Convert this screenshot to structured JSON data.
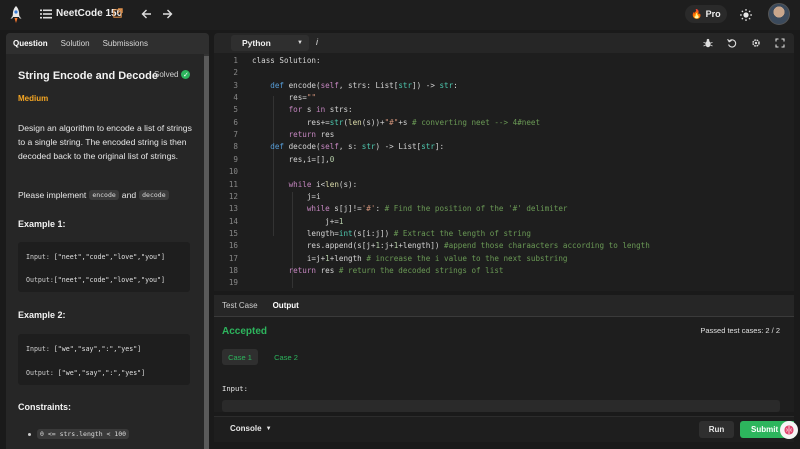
{
  "header": {
    "brand": "NeetCode 150",
    "pro_label": "Pro"
  },
  "left_panel": {
    "tabs": [
      {
        "label": "Question",
        "active": true
      },
      {
        "label": "Solution",
        "active": false
      },
      {
        "label": "Submissions",
        "active": false
      }
    ],
    "title": "String Encode and Decode",
    "solved_label": "Solved",
    "difficulty": "Medium",
    "description": "Design an algorithm to encode a list of strings to a single string. The encoded string is then decoded back to the original list of strings.",
    "implement_prefix": "Please implement",
    "implement_fn1": "encode",
    "implement_and": "and",
    "implement_fn2": "decode",
    "example1": {
      "title": "Example 1:",
      "input_label": "Input:",
      "input_value": "[\"neet\",\"code\",\"love\",\"you\"]",
      "output_label": "Output:",
      "output_value": "[\"neet\",\"code\",\"love\",\"you\"]"
    },
    "example2": {
      "title": "Example 2:",
      "input_label": "Input:",
      "input_value": "[\"we\",\"say\",\":\",\"yes\"]",
      "output_label": "Output:",
      "output_value": "[\"we\",\"say\",\":\",\"yes\"]"
    },
    "constraints_title": "Constraints:",
    "constraint1": "0 <= strs.length < 100"
  },
  "editor": {
    "language": "Python",
    "info_label": "i",
    "lines": [
      [
        {
          "t": "class Solution:",
          "c": "#d4d4d4"
        }
      ],
      [],
      [
        {
          "t": "    def ",
          "c": "#569cd6"
        },
        {
          "t": "encode(",
          "c": "#d4d4d4"
        },
        {
          "t": "self",
          "c": "#c586c0"
        },
        {
          "t": ", strs: List[",
          "c": "#d4d4d4"
        },
        {
          "t": "str",
          "c": "#4ec9b0"
        },
        {
          "t": "]) -> ",
          "c": "#d4d4d4"
        },
        {
          "t": "str",
          "c": "#4ec9b0"
        },
        {
          "t": ":",
          "c": "#d4d4d4"
        }
      ],
      [
        {
          "t": "        res=",
          "c": "#d4d4d4"
        },
        {
          "t": "\"\"",
          "c": "#ce9178"
        }
      ],
      [
        {
          "t": "        for ",
          "c": "#c586c0"
        },
        {
          "t": "s ",
          "c": "#d4d4d4"
        },
        {
          "t": "in ",
          "c": "#c586c0"
        },
        {
          "t": "strs:",
          "c": "#d4d4d4"
        }
      ],
      [
        {
          "t": "            res+=",
          "c": "#d4d4d4"
        },
        {
          "t": "str",
          "c": "#4ec9b0"
        },
        {
          "t": "(",
          "c": "#d4d4d4"
        },
        {
          "t": "len",
          "c": "#dcdcaa"
        },
        {
          "t": "(s))+",
          "c": "#d4d4d4"
        },
        {
          "t": "\"#\"",
          "c": "#ce9178"
        },
        {
          "t": "+s ",
          "c": "#d4d4d4"
        },
        {
          "t": "# converting neet --> 4#neet",
          "c": "#6a9955"
        }
      ],
      [
        {
          "t": "        return ",
          "c": "#c586c0"
        },
        {
          "t": "res",
          "c": "#d4d4d4"
        }
      ],
      [
        {
          "t": "    def ",
          "c": "#569cd6"
        },
        {
          "t": "decode(",
          "c": "#d4d4d4"
        },
        {
          "t": "self",
          "c": "#c586c0"
        },
        {
          "t": ", s: ",
          "c": "#d4d4d4"
        },
        {
          "t": "str",
          "c": "#4ec9b0"
        },
        {
          "t": ") -> List[",
          "c": "#d4d4d4"
        },
        {
          "t": "str",
          "c": "#4ec9b0"
        },
        {
          "t": "]:",
          "c": "#d4d4d4"
        }
      ],
      [
        {
          "t": "        res,i=[],",
          "c": "#d4d4d4"
        },
        {
          "t": "0",
          "c": "#b5cea8"
        }
      ],
      [],
      [
        {
          "t": "        while ",
          "c": "#c586c0"
        },
        {
          "t": "i<",
          "c": "#d4d4d4"
        },
        {
          "t": "len",
          "c": "#dcdcaa"
        },
        {
          "t": "(s):",
          "c": "#d4d4d4"
        }
      ],
      [
        {
          "t": "            j=i",
          "c": "#d4d4d4"
        }
      ],
      [
        {
          "t": "            while ",
          "c": "#c586c0"
        },
        {
          "t": "s[j]!=",
          "c": "#d4d4d4"
        },
        {
          "t": "'#'",
          "c": "#ce9178"
        },
        {
          "t": ": ",
          "c": "#d4d4d4"
        },
        {
          "t": "# Find the position of the '#' delimiter",
          "c": "#6a9955"
        }
      ],
      [
        {
          "t": "                j+=",
          "c": "#d4d4d4"
        },
        {
          "t": "1",
          "c": "#b5cea8"
        }
      ],
      [
        {
          "t": "            length=",
          "c": "#d4d4d4"
        },
        {
          "t": "int",
          "c": "#4ec9b0"
        },
        {
          "t": "(s[i:j]) ",
          "c": "#d4d4d4"
        },
        {
          "t": "# Extract the length of string",
          "c": "#6a9955"
        }
      ],
      [
        {
          "t": "            res.append(s[j+",
          "c": "#d4d4d4"
        },
        {
          "t": "1",
          "c": "#b5cea8"
        },
        {
          "t": ":j+",
          "c": "#d4d4d4"
        },
        {
          "t": "1",
          "c": "#b5cea8"
        },
        {
          "t": "+length]) ",
          "c": "#d4d4d4"
        },
        {
          "t": "#append those charaacters according to length",
          "c": "#6a9955"
        }
      ],
      [
        {
          "t": "            i=j+",
          "c": "#d4d4d4"
        },
        {
          "t": "1",
          "c": "#b5cea8"
        },
        {
          "t": "+length ",
          "c": "#d4d4d4"
        },
        {
          "t": "# increase the i value to the next substring",
          "c": "#6a9955"
        }
      ],
      [
        {
          "t": "        return ",
          "c": "#c586c0"
        },
        {
          "t": "res ",
          "c": "#d4d4d4"
        },
        {
          "t": "# return the decoded strings of list",
          "c": "#6a9955"
        }
      ],
      [],
      []
    ]
  },
  "output": {
    "tabs": [
      {
        "label": "Test Case",
        "active": false
      },
      {
        "label": "Output",
        "active": true
      }
    ],
    "status": "Accepted",
    "passed": "Passed test cases: 2 / 2",
    "cases": [
      "Case 1",
      "Case 2"
    ],
    "input_label": "Input:"
  },
  "bottom": {
    "console_label": "Console",
    "run_label": "Run",
    "submit_label": "Submit"
  }
}
